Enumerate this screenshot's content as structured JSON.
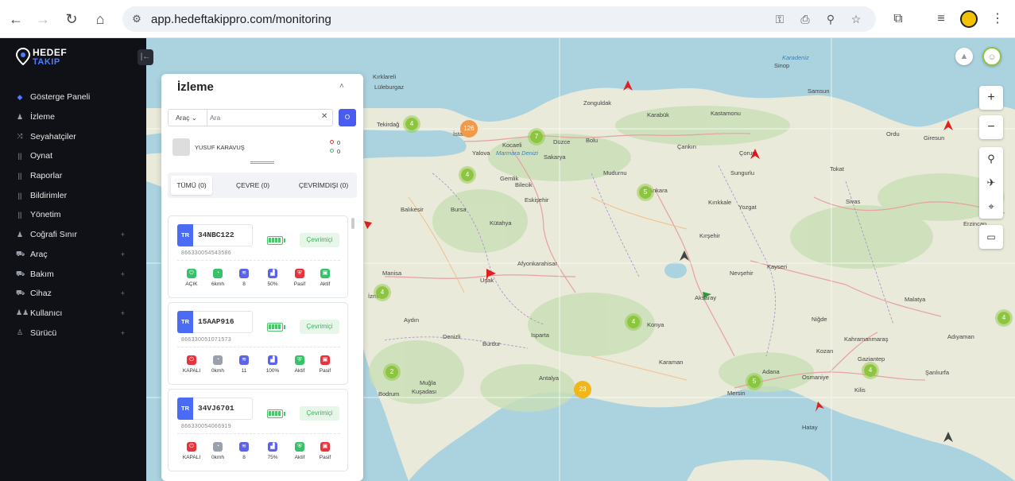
{
  "browser": {
    "url": "app.hedeftakippro.com/monitoring"
  },
  "brand": {
    "line1": "HEDEF",
    "line2": "TAKIP"
  },
  "sidebar": {
    "items": [
      {
        "label": "Gösterge Paneli",
        "icon": "dashboard-icon",
        "expandable": false,
        "active": true
      },
      {
        "label": "İzleme",
        "icon": "user-icon",
        "expandable": false
      },
      {
        "label": "Seyahatçiler",
        "icon": "route-icon",
        "expandable": false
      },
      {
        "label": "Oynat",
        "icon": "bars-icon",
        "expandable": false
      },
      {
        "label": "Raporlar",
        "icon": "bars-icon",
        "expandable": false
      },
      {
        "label": "Bildirimler",
        "icon": "bars-icon",
        "expandable": false
      },
      {
        "label": "Yönetim",
        "icon": "bars-icon",
        "expandable": false
      },
      {
        "label": "Coğrafi Sınır",
        "icon": "user-icon",
        "expandable": true
      },
      {
        "label": "Araç",
        "icon": "car-icon",
        "expandable": true
      },
      {
        "label": "Bakım",
        "icon": "car-icon",
        "expandable": true
      },
      {
        "label": "Cihaz",
        "icon": "car-icon",
        "expandable": true
      },
      {
        "label": "Kullanıcı",
        "icon": "users-icon",
        "expandable": true
      },
      {
        "label": "Sürücü",
        "icon": "driver-icon",
        "expandable": true
      }
    ]
  },
  "panel": {
    "title": "İzleme",
    "search": {
      "type": "Araç",
      "placeholder": "Ara"
    },
    "user": {
      "name": "YUSUF KARAVUŞ",
      "count_red": "0",
      "count_green": "0"
    },
    "tabs": [
      {
        "label": "TÜMÜ",
        "count": "(0)"
      },
      {
        "label": "ÇEVRE",
        "count": "(0)"
      },
      {
        "label": "ÇEVRİMDIŞI",
        "count": "(0)"
      }
    ],
    "vehicles": [
      {
        "country": "TR",
        "plate": "34NBC122",
        "imei": "866330054543586",
        "status": "Çevrimiçi",
        "stats": [
          {
            "label": "AÇIK",
            "icon": "power-icon",
            "color": "#37c26a"
          },
          {
            "label": "6kmh",
            "icon": "speed-icon",
            "color": "#37c26a"
          },
          {
            "label": "8",
            "icon": "satellite-icon",
            "color": "#5b63e8"
          },
          {
            "label": "50%",
            "icon": "signal-icon",
            "color": "#5b63e8"
          },
          {
            "label": "Pasif",
            "icon": "shield-icon",
            "color": "#e8333c"
          },
          {
            "label": "Aktif",
            "icon": "lock-icon",
            "color": "#37c26a"
          }
        ]
      },
      {
        "country": "TR",
        "plate": "15AAP916",
        "imei": "866330051071573",
        "status": "Çevrimiçi",
        "stats": [
          {
            "label": "KAPALI",
            "icon": "power-icon",
            "color": "#e8333c"
          },
          {
            "label": "0kmh",
            "icon": "speed-icon",
            "color": "#9aa0ac"
          },
          {
            "label": "11",
            "icon": "satellite-icon",
            "color": "#5b63e8"
          },
          {
            "label": "100%",
            "icon": "signal-icon",
            "color": "#5b63e8"
          },
          {
            "label": "Aktif",
            "icon": "shield-icon",
            "color": "#37c26a"
          },
          {
            "label": "Pasif",
            "icon": "lock-icon",
            "color": "#e8333c"
          }
        ]
      },
      {
        "country": "TR",
        "plate": "34VJ6701",
        "imei": "866330054066919",
        "status": "Çevrimiçi",
        "stats": [
          {
            "label": "KAPALI",
            "icon": "power-icon",
            "color": "#e8333c"
          },
          {
            "label": "0kmh",
            "icon": "speed-icon",
            "color": "#9aa0ac"
          },
          {
            "label": "8",
            "icon": "satellite-icon",
            "color": "#5b63e8"
          },
          {
            "label": "75%",
            "icon": "signal-icon",
            "color": "#5b63e8"
          },
          {
            "label": "Aktif",
            "icon": "shield-icon",
            "color": "#37c26a"
          },
          {
            "label": "Pasif",
            "icon": "lock-icon",
            "color": "#e8333c"
          }
        ]
      }
    ]
  },
  "map": {
    "clusters": [
      "4",
      "126",
      "7",
      "4",
      "5",
      "4",
      "4",
      "2",
      "23",
      "5",
      "4",
      "4"
    ],
    "places": [
      "Kırklareli",
      "Lüleburgaz",
      "İstanbul",
      "Tekirdağ",
      "Zonguldak",
      "Kastamonu",
      "Sinop",
      "Samsun",
      "Ordu",
      "Giresun",
      "Çorum",
      "Çankırı",
      "Kocaeli",
      "Sakarya",
      "Yalova",
      "Bolu",
      "Düzce",
      "Karabük",
      "Bilecik",
      "Bursa",
      "Eskişehir",
      "Balıkesir",
      "Kütahya",
      "Ankara",
      "Kırıkkale",
      "Yozgat",
      "Sivas",
      "Tokat",
      "Erzincan",
      "Manisa",
      "İzmir",
      "Uşak",
      "Afyonkarahisar",
      "Kırşehir",
      "Nevşehir",
      "Kayseri",
      "Aksaray",
      "Malatya",
      "Aydın",
      "Denizli",
      "Isparta",
      "Konya",
      "Niğde",
      "Kahramanmaraş",
      "Adıyaman",
      "Muğla",
      "Burdur",
      "Antalya",
      "Karaman",
      "Adana",
      "Osmaniye",
      "Gaziantep",
      "Şanlıurfa",
      "Mersin",
      "Hatay",
      "Kilis",
      "Kuşadası",
      "Gemlik",
      "Bodrum",
      "Mudurnu",
      "Sungurlu",
      "Kozan"
    ],
    "seas": [
      "Marmara Denizi",
      "Karadeniz"
    ]
  }
}
